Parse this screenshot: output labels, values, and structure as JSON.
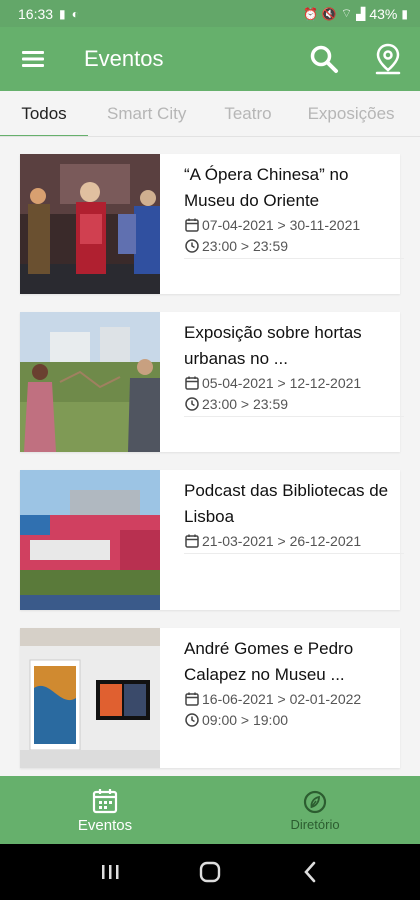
{
  "status_bar": {
    "time": "16:33",
    "battery": "43%"
  },
  "app_bar": {
    "title": "Eventos"
  },
  "tabs": [
    {
      "label": "Todos",
      "active": true
    },
    {
      "label": "Smart City",
      "active": false
    },
    {
      "label": "Teatro",
      "active": false
    },
    {
      "label": "Exposições",
      "active": false
    }
  ],
  "events": [
    {
      "title": "“A Ópera Chinesa” no Museu do Oriente",
      "dates": "07-04-2021 > 30-11-2021",
      "hours": "23:00 > 23:59"
    },
    {
      "title": "Exposição sobre hortas urbanas no ...",
      "dates": "05-04-2021 > 12-12-2021",
      "hours": "23:00 > 23:59"
    },
    {
      "title": "Podcast das Bibliotecas de Lisboa",
      "dates": "21-03-2021 > 26-12-2021",
      "hours": ""
    },
    {
      "title": "André Gomes e Pedro Calapez no Museu ...",
      "dates": "16-06-2021 > 02-01-2022",
      "hours": "09:00 > 19:00"
    }
  ],
  "bottom_nav": {
    "eventos": "Eventos",
    "diretorio": "Diretório"
  },
  "colors": {
    "primary": "#66b06c",
    "status": "#63a769",
    "inactive_nav": "#2c5d30"
  }
}
